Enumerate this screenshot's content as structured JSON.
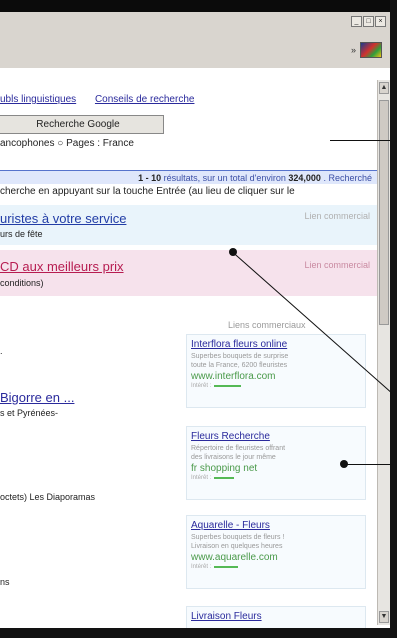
{
  "window": {
    "controls": [
      "_",
      "□",
      "×"
    ],
    "chevron": "»",
    "logo_icon": "windows-flag-logo-icon"
  },
  "top_links": {
    "link1": "ubls linguistiques",
    "link2": "Conseils de recherche"
  },
  "search_button": "Recherche Google",
  "language_line": "ancophones  ○ Pages : France",
  "results": {
    "range": "1 - 10",
    "prefix": "résultats, sur un total d'environ",
    "total": "324,000",
    "suffix": ". Recherché"
  },
  "hint": "cherche en appuyant sur la touche Entrée (au lieu de cliquer sur le",
  "sponsored_top": [
    {
      "title": "uristes à votre service",
      "subtitle": "urs de fête",
      "label": "Lien commercial"
    },
    {
      "title": "CD aux meilleurs prix",
      "subtitle": "conditions)",
      "label": "Lien commercial"
    }
  ],
  "ads_header": "Liens commerciaux",
  "ads": [
    {
      "title": "Interflora fleurs online",
      "description": "Superbes bouquets de surprise\ntoute la France, 6200 fleuristes",
      "url": "www.interflora.com",
      "interest_label": "Intérêt :",
      "interest": 0.8
    },
    {
      "title": "Fleurs Recherche",
      "description": "Répertoire de fleuristes offrant\ndes livraisons le jour même",
      "url": "fr shopping net",
      "interest_label": "Intérêt :",
      "interest": 0.6
    },
    {
      "title": "Aquarelle - Fleurs",
      "description": "Superbes bouquets de fleurs !\nLivraison en quelques heures",
      "url": "www.aquarelle.com",
      "interest_label": "Intérêt :",
      "interest": 0.7
    },
    {
      "title": "Livraison Fleurs",
      "description": "",
      "url": "",
      "interest_label": "",
      "interest": 0
    }
  ],
  "organic": {
    "dot_line": ".",
    "title": "Bigorre en ...",
    "line1": "s et Pyrénées-",
    "line2": "octets) Les Diaporamas",
    "line3": "ns"
  }
}
